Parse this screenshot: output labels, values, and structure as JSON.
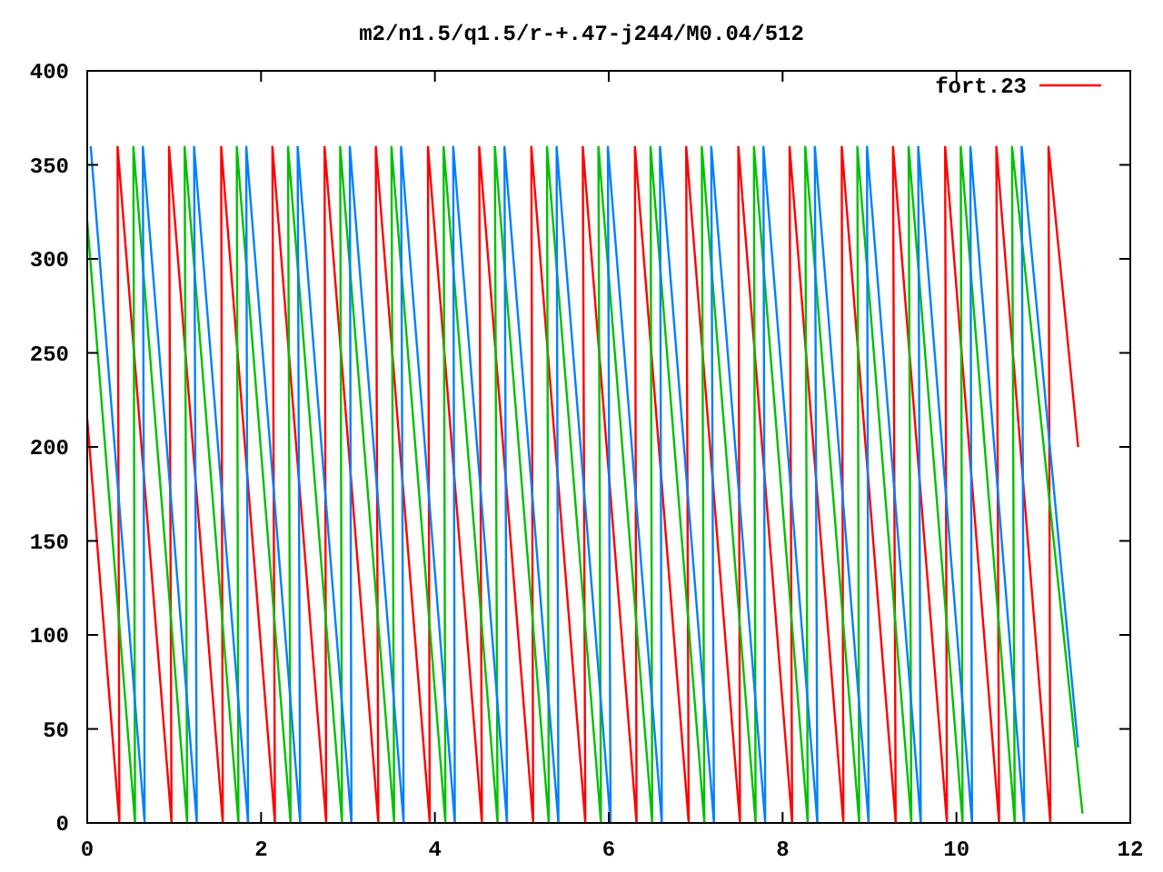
{
  "plot": {
    "chart_data": {
      "type": "line",
      "title": "m2/n1.5/q1.5/r-+.47-j244/M0.04/512",
      "xlim": [
        0,
        12
      ],
      "ylim": [
        0,
        400
      ],
      "xticks": [
        0,
        2,
        4,
        6,
        8,
        10,
        12
      ],
      "yticks": [
        0,
        50,
        100,
        150,
        200,
        250,
        300,
        350,
        400
      ],
      "series": [
        {
          "name": "fort.23",
          "color": "#ff0000",
          "x": [
            0,
            0.37,
            0.35,
            0.97,
            0.94,
            1.56,
            1.54,
            2.16,
            2.13,
            2.75,
            2.73,
            3.35,
            3.32,
            3.94,
            3.92,
            4.54,
            4.51,
            5.13,
            5.11,
            5.73,
            5.7,
            6.32,
            6.3,
            6.92,
            6.89,
            7.51,
            7.49,
            8.11,
            8.08,
            8.7,
            8.68,
            9.3,
            9.27,
            9.89,
            9.87,
            10.49,
            10.46,
            11.08,
            11.06,
            11.4
          ],
          "values": [
            215,
            0,
            360,
            0,
            360,
            0,
            360,
            0,
            360,
            0,
            360,
            0,
            360,
            0,
            360,
            0,
            360,
            0,
            360,
            0,
            360,
            0,
            360,
            0,
            360,
            0,
            360,
            0,
            360,
            0,
            360,
            0,
            360,
            0,
            360,
            0,
            360,
            0,
            360,
            200
          ]
        },
        {
          "color": "#00c000",
          "x": [
            0,
            0.55,
            0.53,
            1.15,
            1.12,
            1.74,
            1.72,
            2.34,
            2.31,
            2.93,
            2.91,
            3.53,
            3.5,
            4.12,
            4.1,
            4.72,
            4.69,
            5.31,
            5.29,
            5.91,
            5.88,
            6.5,
            6.48,
            7.1,
            7.07,
            7.69,
            7.67,
            8.29,
            8.26,
            8.88,
            8.86,
            9.48,
            9.45,
            10.07,
            10.05,
            10.67,
            10.64,
            11.45
          ],
          "values": [
            320,
            0,
            360,
            0,
            360,
            0,
            360,
            0,
            360,
            0,
            360,
            0,
            360,
            0,
            360,
            0,
            360,
            0,
            360,
            0,
            360,
            0,
            360,
            0,
            360,
            0,
            360,
            0,
            360,
            0,
            360,
            0,
            360,
            0,
            360,
            0,
            360,
            5
          ]
        },
        {
          "color": "#0080ff",
          "x": [
            0.04,
            0.66,
            0.64,
            1.26,
            1.23,
            1.85,
            1.83,
            2.45,
            2.42,
            3.04,
            3.02,
            3.64,
            3.61,
            4.23,
            4.21,
            4.83,
            4.8,
            5.42,
            5.4,
            6.02,
            5.99,
            6.61,
            6.59,
            7.21,
            7.18,
            7.8,
            7.78,
            8.4,
            8.37,
            8.99,
            8.97,
            9.59,
            9.56,
            10.18,
            10.16,
            10.78,
            10.75,
            11.4
          ],
          "values": [
            360,
            0,
            360,
            0,
            360,
            0,
            360,
            0,
            360,
            0,
            360,
            0,
            360,
            0,
            360,
            0,
            360,
            0,
            360,
            0,
            360,
            0,
            360,
            0,
            360,
            0,
            360,
            0,
            360,
            0,
            360,
            0,
            360,
            0,
            360,
            0,
            360,
            40
          ]
        }
      ]
    }
  }
}
